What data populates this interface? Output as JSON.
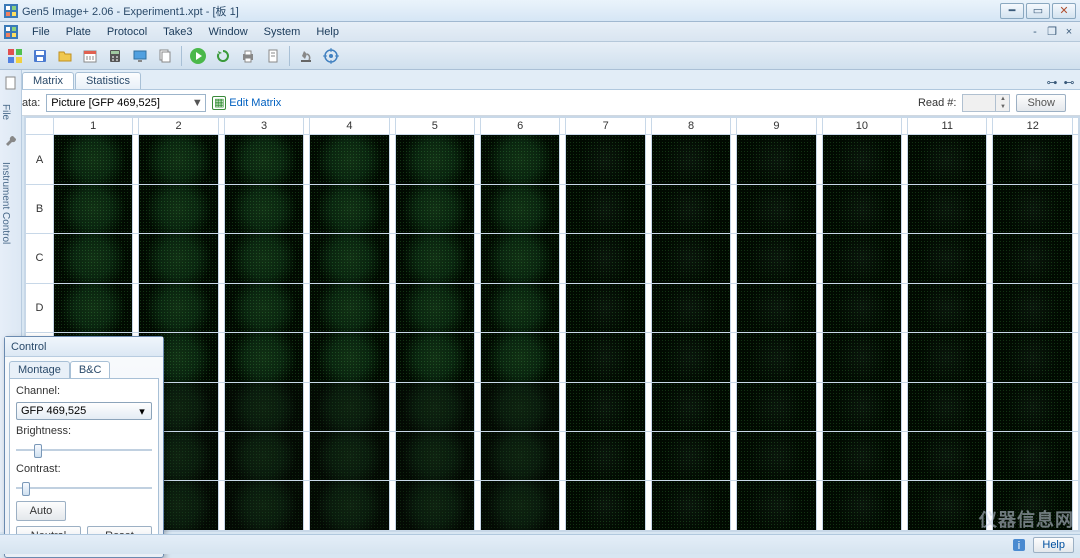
{
  "window": {
    "title": "Gen5 Image+ 2.06 - Experiment1.xpt - [板 1]"
  },
  "menu": {
    "items": [
      "File",
      "Plate",
      "Protocol",
      "Take3",
      "Window",
      "System",
      "Help"
    ]
  },
  "tabs": {
    "matrix": "Matrix",
    "statistics": "Statistics"
  },
  "sidebar": {
    "label1": "File",
    "label2": "Instrument Control"
  },
  "databar": {
    "data_label": "Data:",
    "data_value": "Picture [GFP 469,525]",
    "edit_matrix": "Edit Matrix",
    "read_label": "Read #:",
    "show": "Show"
  },
  "plate": {
    "cols": [
      "1",
      "2",
      "3",
      "4",
      "5",
      "6",
      "7",
      "8",
      "9",
      "10",
      "11",
      "12"
    ],
    "rows": [
      "A",
      "B",
      "C",
      "D"
    ]
  },
  "control": {
    "title": "Control",
    "tab_montage": "Montage",
    "tab_bc": "B&C",
    "channel_label": "Channel:",
    "channel_value": "GFP 469,525",
    "brightness_label": "Brightness:",
    "contrast_label": "Contrast:",
    "auto": "Auto",
    "neutral": "Neutral",
    "reset": "Reset"
  },
  "bottom": {
    "help": "Help"
  },
  "watermark": "仪器信息网",
  "icons": {
    "save": "save-icon",
    "folder": "folder-icon",
    "calendar": "calendar-icon",
    "calculator": "calculator-icon",
    "screen": "screen-icon",
    "copy": "copy-icon",
    "play": "play-icon",
    "refresh": "refresh-icon",
    "print": "print-icon",
    "doc": "doc-icon",
    "pipette": "pipette-icon",
    "target": "target-icon"
  }
}
